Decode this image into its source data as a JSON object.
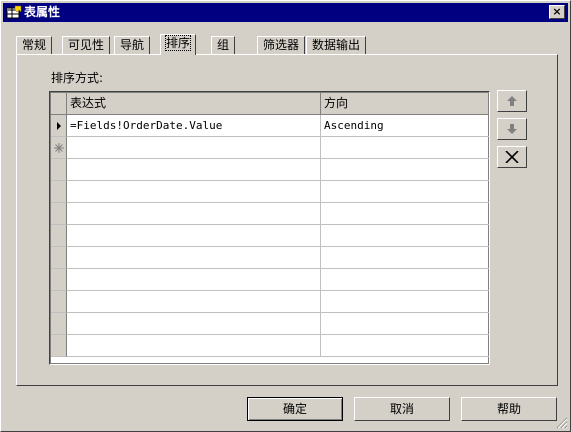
{
  "window": {
    "title": "表属性",
    "close_label": "×"
  },
  "tabs": [
    {
      "label": "常规"
    },
    {
      "label": "可见性"
    },
    {
      "label": "导航"
    },
    {
      "label": "排序"
    },
    {
      "label": "组"
    },
    {
      "label": "筛选器"
    },
    {
      "label": "数据输出"
    }
  ],
  "active_tab": "排序",
  "sort": {
    "label": "排序方式:",
    "columns": [
      "表达式",
      "方向"
    ],
    "rows": [
      {
        "expression": "=Fields!OrderDate.Value",
        "direction": "Ascending",
        "indicator": "current"
      },
      {
        "expression": "",
        "direction": "",
        "indicator": "new"
      }
    ]
  },
  "side_buttons": [
    "move-up",
    "move-down",
    "delete"
  ],
  "footer": {
    "ok": "确定",
    "cancel": "取消",
    "help": "帮助"
  },
  "colors": {
    "title_bar": "#000080",
    "face": "#d4d0c8"
  }
}
